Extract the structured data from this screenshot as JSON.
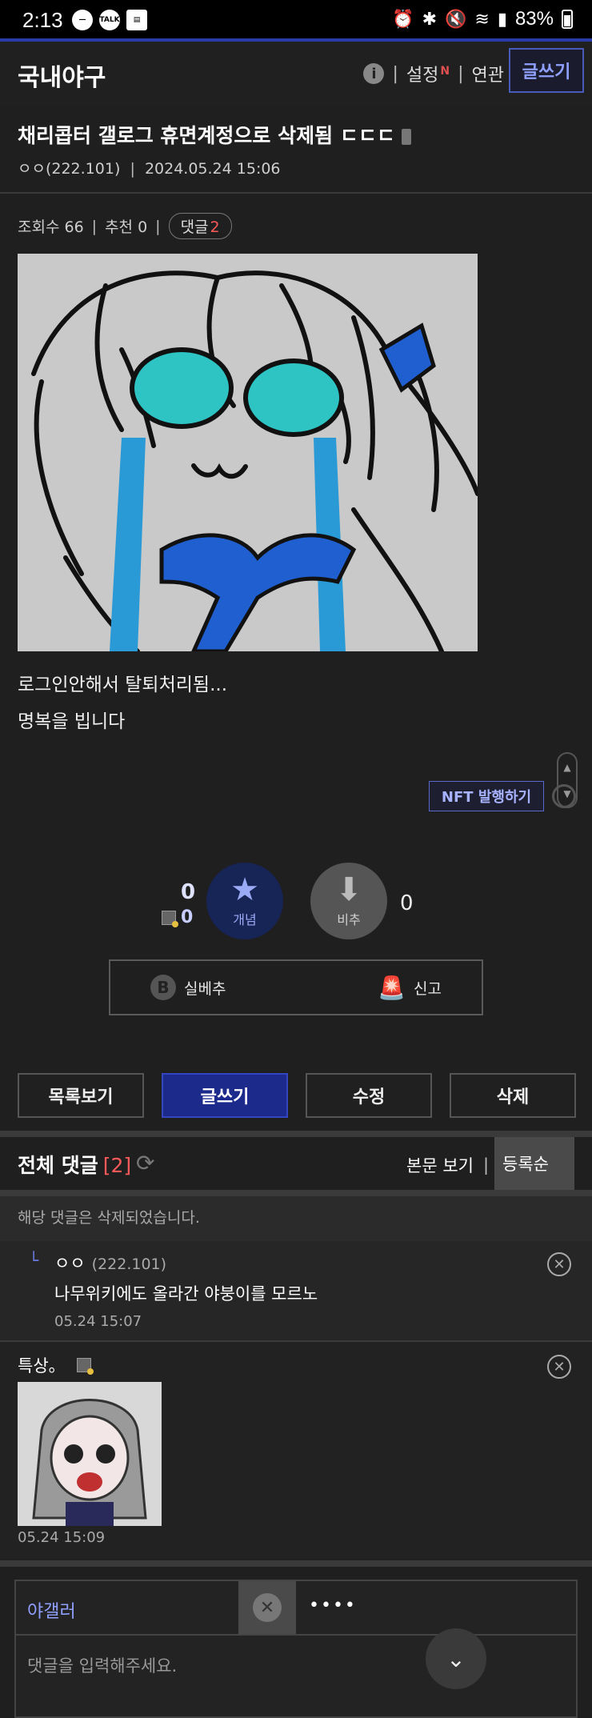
{
  "status_bar": {
    "time": "2:13",
    "left_icons": [
      "minus-circle-icon",
      "talk-icon",
      "clipboard-icon"
    ],
    "talk_label": "TALK",
    "battery": "83%"
  },
  "header": {
    "board_title": "국내야구",
    "info_label": "i",
    "settings_label": "설정",
    "new_badge": "N",
    "related_label": "연관",
    "write_label": "글쓰기"
  },
  "post": {
    "title": "채리콥터 갤로그 휴면계정으로 삭제됨 ㄷㄷㄷ",
    "author": "ㅇㅇ(222.101)",
    "date": "2024.05.24 15:06",
    "views_label": "조회수 66",
    "recommend_label": "추천 0",
    "comment_label": "댓글",
    "comment_count": "2",
    "body_lines": [
      "로그인안해서 탈퇴처리됨...",
      "명복을 빕니다"
    ]
  },
  "nft_label": "NFT 발행하기",
  "votes": {
    "up_count": "0",
    "up_sub_count": "0",
    "up_label": "개념",
    "down_label": "비추",
    "down_count": "0"
  },
  "actions": {
    "best_label": "실베추",
    "report_label": "신고"
  },
  "bottom_buttons": [
    "목록보기",
    "글쓰기",
    "수정",
    "삭제"
  ],
  "comments": {
    "header_label": "전체 댓글",
    "count": "[2]",
    "view_body_label": "본문 보기",
    "sort_label": "등록순",
    "deleted_notice": "해당 댓글은 삭제되었습니다.",
    "reply": {
      "author": "ㅇㅇ",
      "ip": "(222.101)",
      "text": "나무위키에도 올라간 야붕이를 모르노",
      "date": "05.24 15:07"
    },
    "second": {
      "author": "특상。",
      "date": "05.24 15:09"
    }
  },
  "input": {
    "nickname": "야갤러",
    "password_mask": "••••",
    "placeholder": "댓글을 입력해주세요."
  },
  "colors": {
    "accent": "#1c2a8c",
    "link_blue": "#8fa0ff",
    "count_red": "#ff5a5a",
    "background": "#1f1f1f"
  }
}
